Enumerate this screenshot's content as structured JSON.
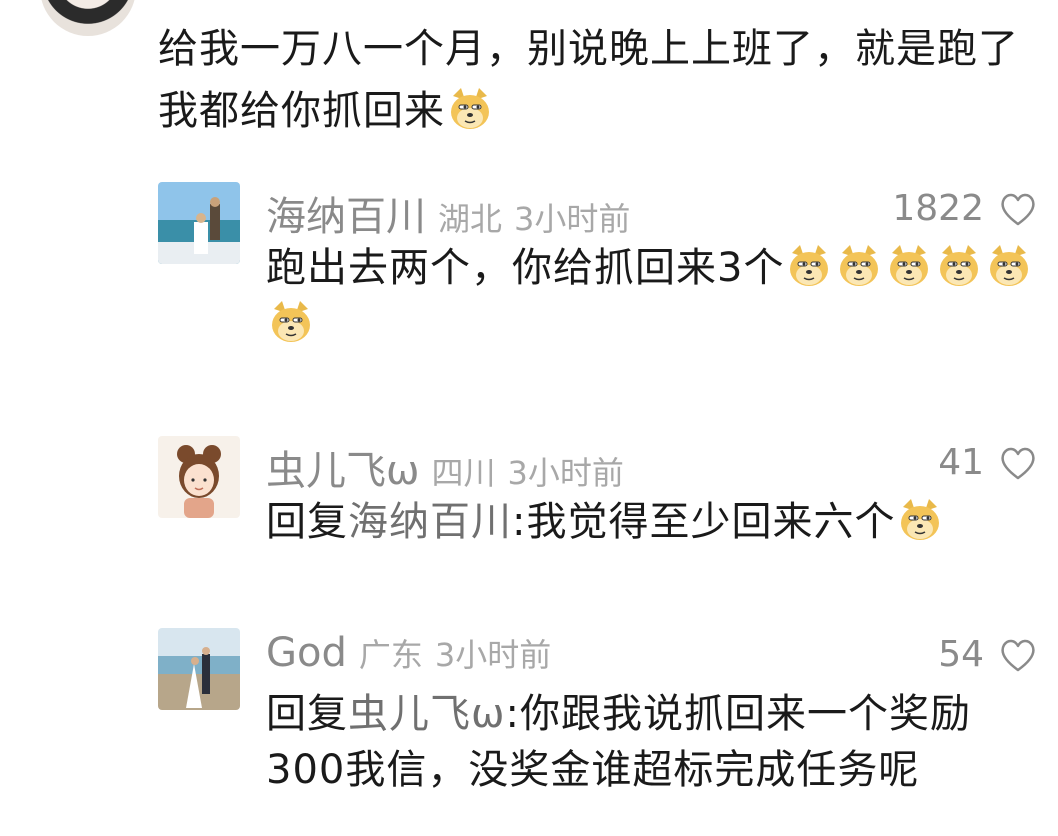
{
  "main_comment": {
    "text": "给我一万八一个月，别说晚上上班了，就是跑了我都给你抓回来"
  },
  "replies": [
    {
      "name": "海纳百川",
      "location": "湖北",
      "time": "3小时前",
      "likes": "1822",
      "prefix": "",
      "mention": "",
      "text": "跑出去两个，你给抓回来3个",
      "emoji_count": 6
    },
    {
      "name": "虫儿飞ω",
      "location": "四川",
      "time": "3小时前",
      "likes": "41",
      "prefix": "回复",
      "mention": "海纳百川",
      "text": ":我觉得至少回来六个",
      "emoji_count": 1
    },
    {
      "name": "God",
      "location": "广东",
      "time": "3小时前",
      "likes": "54",
      "prefix": "回复",
      "mention": "虫儿飞ω",
      "text": ":你跟我说抓回来一个奖励300我信，没奖金谁超标完成任务呢",
      "emoji_count": 0
    }
  ],
  "icons": {
    "heart": "heart-outline-icon",
    "emoji": "doge-emoji-icon"
  },
  "colors": {
    "name": "#8a8a8a",
    "meta": "#a8a8a8",
    "text": "#1a1a1a",
    "mention": "#707070"
  }
}
